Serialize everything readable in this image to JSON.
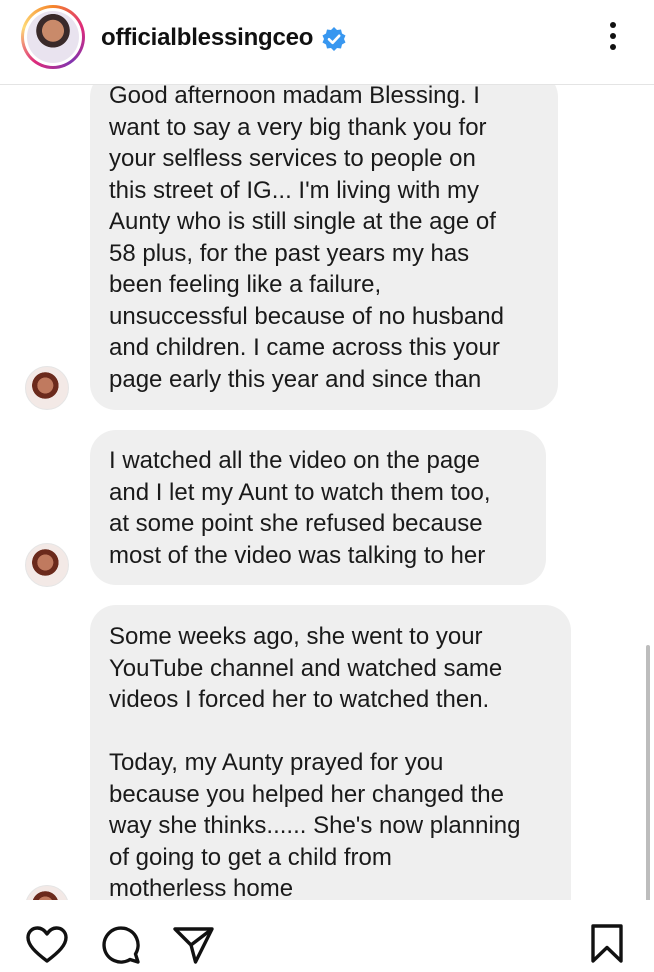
{
  "header": {
    "username": "officialblessingceo",
    "verified_icon": "verified-badge-icon",
    "more_icon": "more-vertical-icon",
    "accent": "#3897f0"
  },
  "messages": [
    {
      "text": "Good afternoon madam Blessing. I\nwant to say a very big thank you for\nyour selfless services to people on\nthis street of IG... I'm living with my\nAunty who is still single at the age of\n58 plus, for the past years my has\nbeen feeling like a failure,\nunsuccessful because of no husband\nand children. I came across this your\npage early this year and since than"
    },
    {
      "text": "I watched all the video on the page\nand I let my Aunt to watch them too,\nat some point she refused because\nmost of the video was talking to her"
    },
    {
      "text": "Some weeks ago, she went to your\nYouTube channel and watched same\nvideos I forced her to watched then.\n\nToday, my Aunty prayed for you\nbecause you helped her changed the\nway she thinks...... She's now planning\nof going to get a child from\nmotherless home"
    }
  ],
  "footer": {
    "icons": [
      "heart-icon",
      "comment-icon",
      "share-icon",
      "bookmark-icon"
    ]
  }
}
